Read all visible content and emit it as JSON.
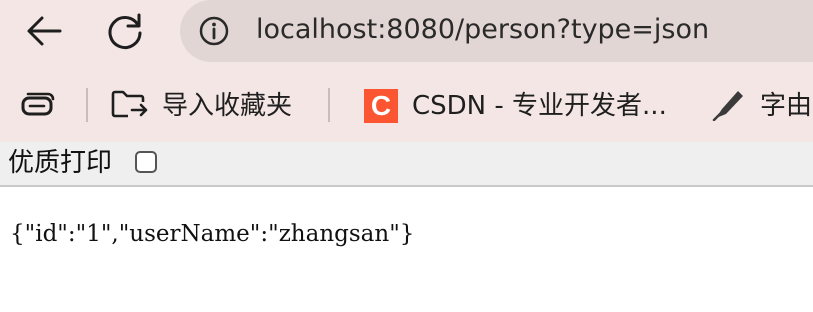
{
  "browser": {
    "back_icon": "arrow-left-icon",
    "reload_icon": "reload-icon",
    "address": {
      "info_icon": "info-icon",
      "url": "localhost:8080/person?type=json"
    },
    "bookmarks": [
      {
        "icon": "collections-icon",
        "label": ""
      },
      {
        "icon": "folder-import-icon",
        "label": "导入收藏夹"
      },
      {
        "icon": "csdn-icon",
        "icon_text": "C",
        "label": "CSDN - 专业开发者..."
      },
      {
        "icon": "pen-icon",
        "label": "字由"
      }
    ]
  },
  "page": {
    "print_label": "优质打印",
    "print_checked": false,
    "json_text": "{\"id\":\"1\",\"userName\":\"zhangsan\"}"
  },
  "colors": {
    "chrome_bg": "#f3e6e4",
    "address_bg": "#e2d6d4",
    "csdn_brand": "#fc5531",
    "printbar_bg": "#efefef"
  }
}
